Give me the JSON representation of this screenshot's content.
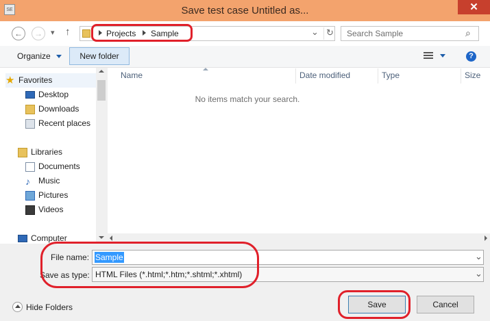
{
  "window": {
    "title": "Save test case Untitled as...",
    "app_icon_label": "SE",
    "close_glyph": "✕"
  },
  "nav": {
    "back_glyph": "←",
    "forward_glyph": "→",
    "history_glyph": "▾",
    "up_glyph": "↑",
    "breadcrumb": [
      "Projects",
      "Sample"
    ],
    "dropdown_glyph": "⌄",
    "refresh_glyph": "↻",
    "search_placeholder": "Search Sample",
    "search_glyph": "⌕"
  },
  "toolbar": {
    "organize_label": "Organize",
    "new_folder_label": "New folder",
    "help_glyph": "?"
  },
  "sidebar": {
    "favorites": {
      "label": "Favorites",
      "items": [
        "Desktop",
        "Downloads",
        "Recent places"
      ]
    },
    "libraries": {
      "label": "Libraries",
      "items": [
        "Documents",
        "Music",
        "Pictures",
        "Videos"
      ]
    },
    "computer_label": "Computer"
  },
  "columns": [
    "Name",
    "Date modified",
    "Type",
    "Size"
  ],
  "empty_message": "No items match your search.",
  "form": {
    "filename_label": "File name:",
    "filename_value": "Sample",
    "type_label": "Save as type:",
    "type_value": "HTML Files (*.html;*.htm;*.shtml;*.xhtml)"
  },
  "footer": {
    "hide_folders_label": "Hide Folders",
    "save_label": "Save",
    "cancel_label": "Cancel"
  },
  "colors": {
    "titlebar": "#f3a36d",
    "close": "#c7402d",
    "highlight": "#e0202a",
    "selection": "#3399ff"
  }
}
